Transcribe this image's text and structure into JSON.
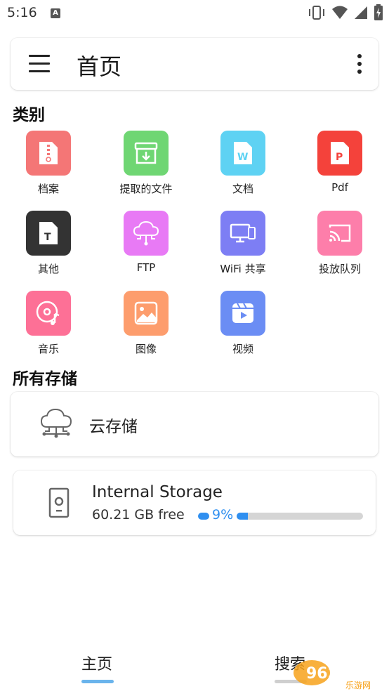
{
  "status_bar": {
    "time": "5:16",
    "notif_letter": "A"
  },
  "header": {
    "title": "首页"
  },
  "categories": {
    "title": "类别",
    "items": [
      {
        "label": "档案",
        "color": "#f47676",
        "icon": "archive-zip-icon",
        "glyph": ""
      },
      {
        "label": "提取的文件",
        "color": "#6fd673",
        "icon": "extract-download-icon",
        "glyph": ""
      },
      {
        "label": "文档",
        "color": "#5ed2f3",
        "icon": "word-document-icon",
        "glyph": "W"
      },
      {
        "label": "Pdf",
        "color": "#f4423b",
        "icon": "pdf-document-icon",
        "glyph": "P"
      },
      {
        "label": "其他",
        "color": "#333333",
        "icon": "text-file-icon",
        "glyph": "T"
      },
      {
        "label": "FTP",
        "color": "#e87af5",
        "icon": "cloud-network-icon",
        "glyph": ""
      },
      {
        "label": "WiFi 共享",
        "color": "#7d7ef4",
        "icon": "devices-icon",
        "glyph": ""
      },
      {
        "label": "投放队列",
        "color": "#fd7eaa",
        "icon": "cast-icon",
        "glyph": ""
      },
      {
        "label": "音乐",
        "color": "#fd7096",
        "icon": "music-disc-icon",
        "glyph": ""
      },
      {
        "label": "图像",
        "color": "#fd9d6d",
        "icon": "image-icon",
        "glyph": ""
      },
      {
        "label": "视频",
        "color": "#6b8df4",
        "icon": "video-play-icon",
        "glyph": ""
      }
    ]
  },
  "storage": {
    "title": "所有存储",
    "cloud": {
      "label": "云存储",
      "icon": "cloud-network-icon"
    },
    "internal": {
      "name": "Internal Storage",
      "free": "60.21 GB free",
      "percent_text": "9%",
      "used_fraction": 0.09,
      "accent": "#2f8ff0",
      "icon": "phone-storage-icon"
    }
  },
  "bottom_nav": {
    "home_label": "主页",
    "search_label": "搜索",
    "active_color": "#6ab4ec",
    "inactive_color": "#cfcfcf"
  },
  "watermark": {
    "text": "962.NET",
    "sub": "乐游网"
  }
}
